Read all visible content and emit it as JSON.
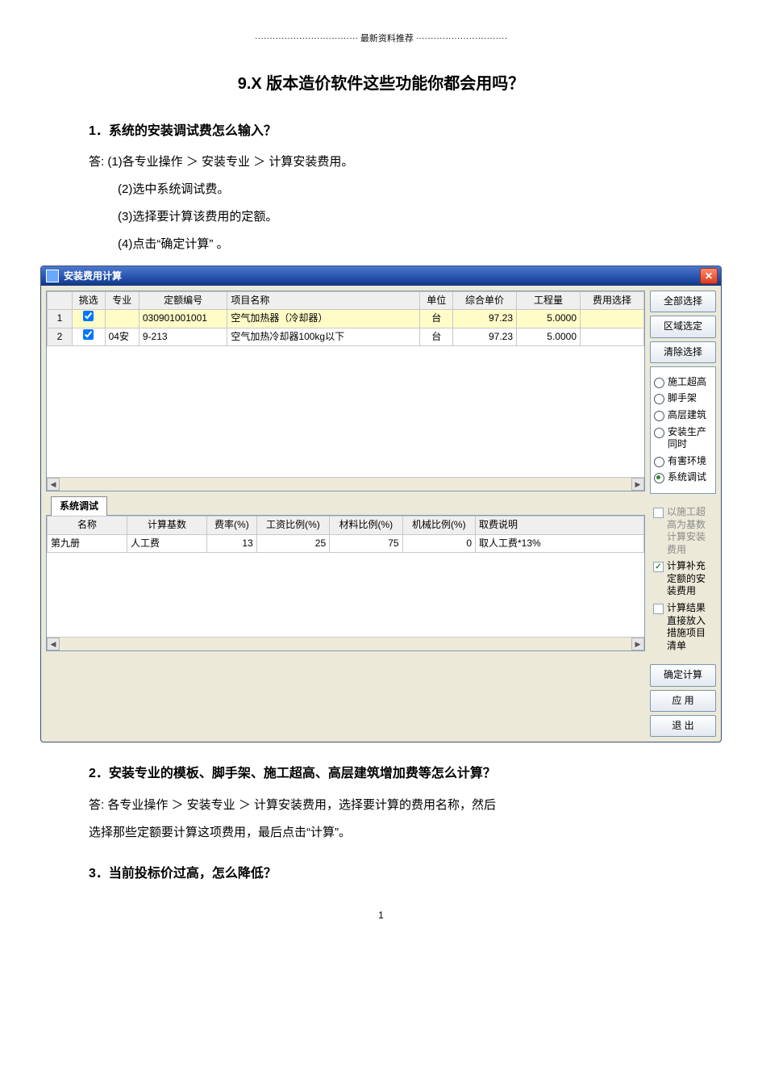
{
  "page": {
    "topline": "··································· 最新资料推荐 ·······························",
    "title": "9.X 版本造价软件这些功能你都会用吗？",
    "q1_heading": "1．系统的安装调试费怎么输入？",
    "answer_prefix": "答:",
    "q1_step1": "(1)各专业操作 ＞ 安装专业 ＞ 计算安装费用。",
    "q1_step2": "(2)选中系统调试费。",
    "q1_step3": "(3)选择要计算该费用的定额。",
    "q1_step4": "(4)点击“确定计算” 。",
    "q2_heading": "2．安装专业的模板、脚手架、施工超高、高层建筑增加费等怎么计算？",
    "q2_body_a": "各专业操作 ＞ 安装专业 ＞ 计算安装费用，选择要计算的费用名称，然后",
    "q2_body_b": "选择那些定额要计算这项费用，最后点击“计算”。",
    "q3_heading": "3．当前投标价过高，怎么降低？",
    "page_number": "1"
  },
  "dialog": {
    "title": "安装费用计算",
    "close_x": "✕",
    "table1": {
      "cols": {
        "pick": "挑选",
        "spec": "专业",
        "code": "定额编号",
        "name": "项目名称",
        "unit": "单位",
        "price": "综合单价",
        "qty": "工程量",
        "sel": "费用选择"
      },
      "rows": [
        {
          "n": "1",
          "checked": true,
          "spec": "",
          "code": "030901001001",
          "name": "空气加热器（冷却器）",
          "unit": "台",
          "price": "97.23",
          "qty": "5.0000",
          "hl": true
        },
        {
          "n": "2",
          "checked": true,
          "spec": "04安",
          "code": "9-213",
          "name": "  空气加热冷却器100kg以下",
          "unit": "台",
          "price": "97.23",
          "qty": "5.0000",
          "hl": false
        }
      ]
    },
    "side_buttons": {
      "all": "全部选择",
      "range": "区域选定",
      "clear": "清除选择",
      "confirm": "确定计算",
      "apply": "应 用",
      "exit": "退 出"
    },
    "radios": [
      {
        "label": "施工超高",
        "checked": false
      },
      {
        "label": "脚手架",
        "checked": false
      },
      {
        "label": "高层建筑",
        "checked": false
      },
      {
        "label": "安装生产同时",
        "checked": false
      },
      {
        "label": "有害环境",
        "checked": false
      },
      {
        "label": "系统调试",
        "checked": true
      }
    ],
    "tab_label": "系统调试",
    "table2": {
      "cols": {
        "name": "名称",
        "base": "计算基数",
        "rate": "费率(%)",
        "wage": "工资比例(%)",
        "material": "材料比例(%)",
        "machine": "机械比例(%)",
        "note": "取费说明"
      },
      "rows": [
        {
          "name": "第九册",
          "base": "人工费",
          "rate": "13",
          "wage": "25",
          "material": "75",
          "machine": "0",
          "note": "取人工费*13%"
        }
      ]
    },
    "checkboxes": [
      {
        "label": "以施工超高为基数计算安装费用",
        "checked": false,
        "muted": true
      },
      {
        "label": "计算补充定额的安装费用",
        "checked": true,
        "muted": false
      },
      {
        "label": "计算结果直接放入措施项目清单",
        "checked": false,
        "muted": false
      }
    ]
  }
}
